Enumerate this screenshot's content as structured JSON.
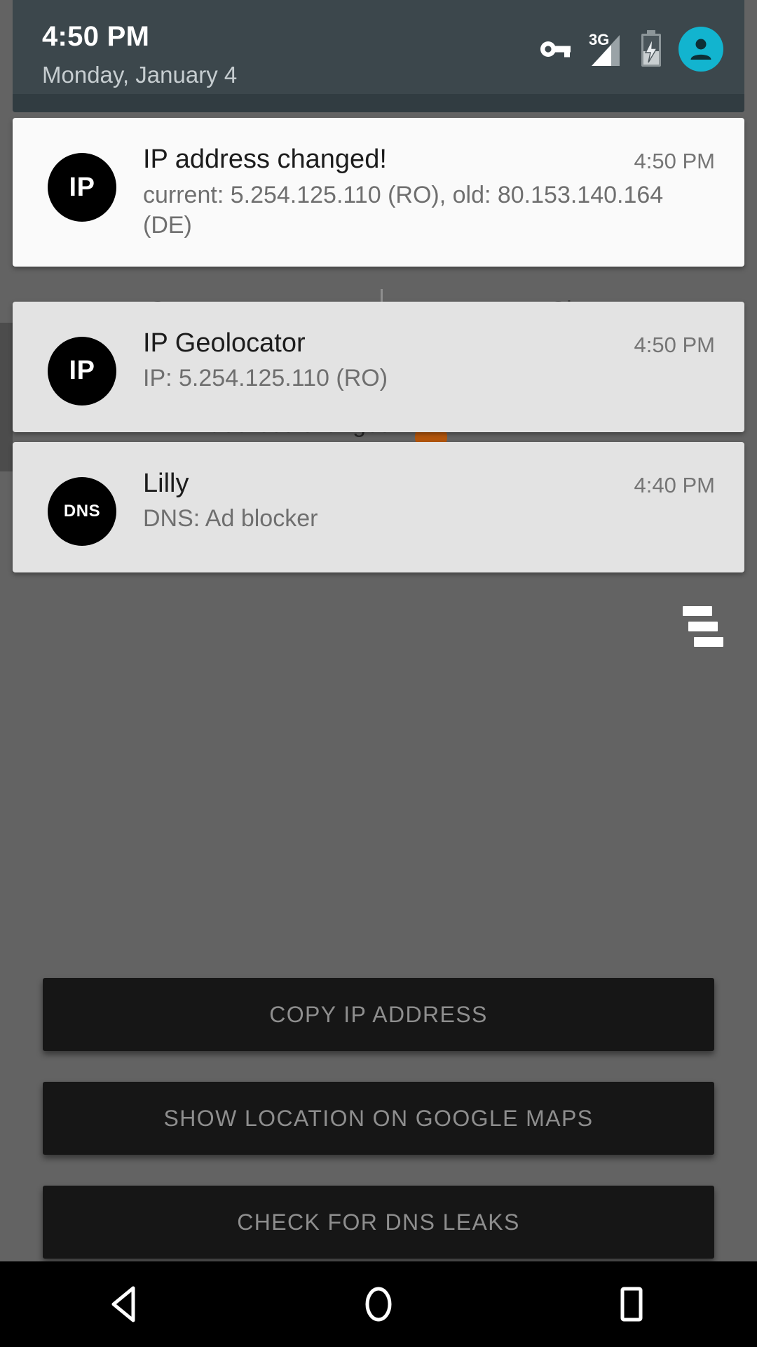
{
  "status_bar": {
    "time": "4:50 PM",
    "date": "Monday, January 4",
    "icons": [
      {
        "name": "vpn-key-icon",
        "label": "key"
      },
      {
        "name": "signal-3g-icon",
        "label": "3G"
      },
      {
        "name": "battery-charging-icon",
        "label": "battery charging"
      },
      {
        "name": "user-avatar-icon",
        "label": "user"
      }
    ],
    "signal_label": "3G",
    "accent_color": "#12b4cf",
    "panel_color": "#3c474c"
  },
  "notifications": [
    {
      "icon_text": "IP",
      "icon_kind": "ip",
      "title": "IP address changed!",
      "text": "current: 5.254.125.110 (RO), old: 80.153.140.164 (DE)",
      "time": "4:50 PM",
      "style": "light"
    },
    {
      "icon_text": "IP",
      "icon_kind": "ip",
      "title": "IP Geolocator",
      "text": "IP: 5.254.125.110 (RO)",
      "time": "4:50 PM",
      "style": "grey"
    },
    {
      "icon_text": "DNS",
      "icon_kind": "dns",
      "title": "Lilly",
      "text": "DNS: Ad blocker",
      "time": "4:40 PM",
      "style": "grey"
    }
  ],
  "background_app": {
    "table_headers": {
      "country": "Country",
      "city": "City"
    },
    "ghost_row_text": "IP address changed",
    "buttons": [
      "COPY IP ADDRESS",
      "SHOW LOCATION ON GOOGLE MAPS",
      "CHECK FOR DNS LEAKS"
    ],
    "overflow_icon": "stagger-bars-icon",
    "surface_color": "#636363",
    "button_color": "#161616"
  },
  "nav_bar": {
    "back": "back-button",
    "home": "home-button",
    "recents": "recents-button"
  }
}
